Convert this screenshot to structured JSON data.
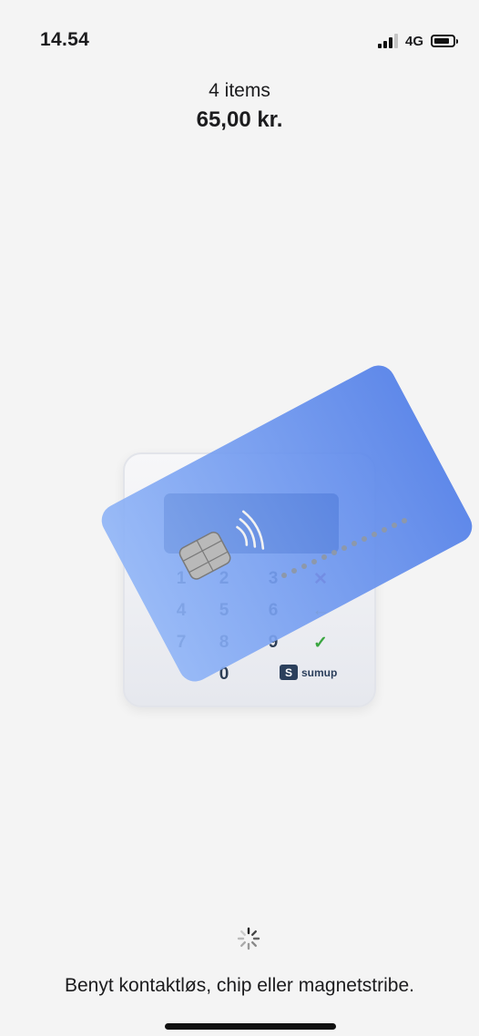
{
  "status_bar": {
    "time": "14.54",
    "network": "4G",
    "signal_icon": "cellular-signal-icon",
    "battery_icon": "battery-icon"
  },
  "payment": {
    "item_count": "4 items",
    "total": "65,00 kr."
  },
  "reader": {
    "keys": [
      "1",
      "2",
      "3",
      "4",
      "5",
      "6",
      "7",
      "8",
      "9",
      "0"
    ],
    "cancel_icon": "cross-icon",
    "back_icon": "back-arrow-icon",
    "confirm_icon": "checkmark-icon",
    "brand": "sumup",
    "brand_mark": "S",
    "colors": {
      "card": "#5b8def",
      "screen": "#1f3c76",
      "cancel": "#a03a7a",
      "back": "#c8b21a",
      "confirm": "#3aa640"
    }
  },
  "loading_icon": "spinner-icon",
  "instruction": "Benyt kontaktløs, chip eller magnetstribe."
}
